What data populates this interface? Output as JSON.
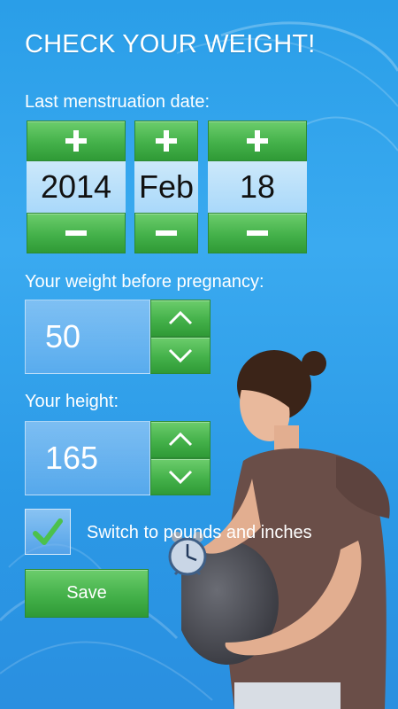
{
  "title": "CHECK YOUR WEIGHT!",
  "lmp": {
    "label": "Last menstruation date:",
    "year": "2014",
    "month": "Feb",
    "day": "18"
  },
  "weight": {
    "label": "Your weight before pregnancy:",
    "value": "50"
  },
  "height": {
    "label": "Your height:",
    "value": "165"
  },
  "units": {
    "label": "Switch to pounds and inches",
    "checked": true
  },
  "save_label": "Save",
  "colors": {
    "accent_green": "#44b14a",
    "background_blue": "#2a9ee8"
  }
}
